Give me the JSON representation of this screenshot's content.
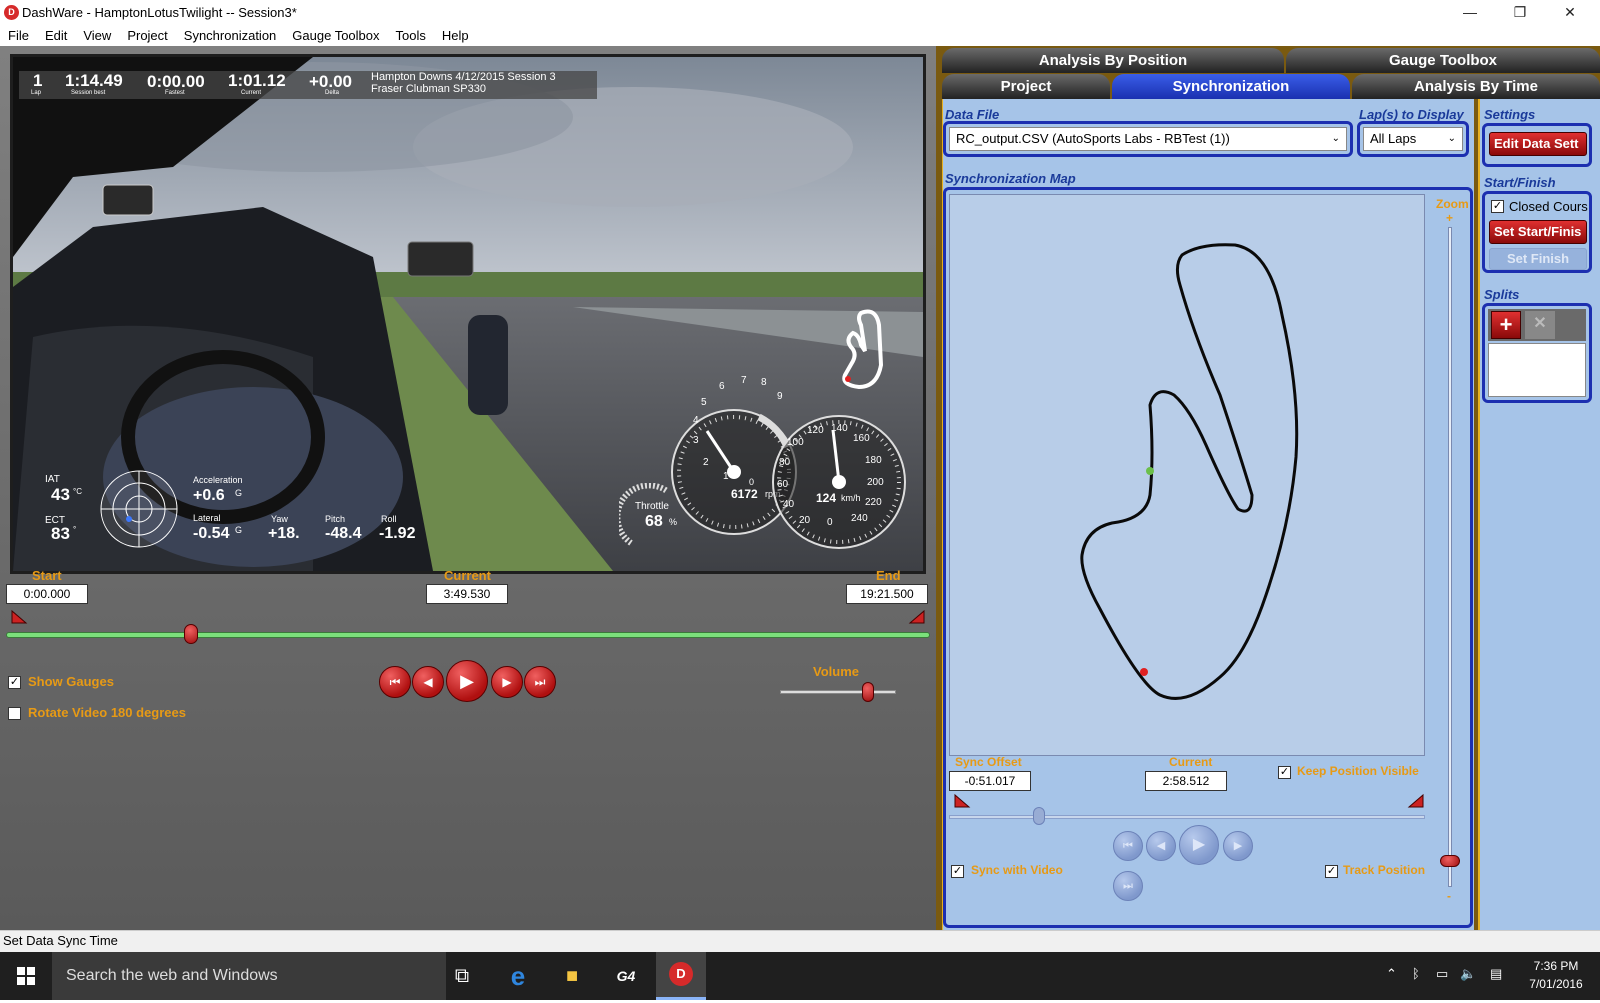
{
  "window": {
    "title": "DashWare - HamptonLotusTwilight -- Session3*",
    "app_icon_letter": "D",
    "controls": {
      "minimize": "—",
      "restore": "❐",
      "close": "✕"
    }
  },
  "menu": [
    "File",
    "Edit",
    "View",
    "Project",
    "Synchronization",
    "Gauge Toolbox",
    "Tools",
    "Help"
  ],
  "video_overlay": {
    "lap_value": "1",
    "lap_label": "Lap",
    "session_best_value": "1:14.49",
    "session_best_label": "Session best",
    "fastest_value": "0:00.00",
    "fastest_label": "Fastest",
    "current_value": "1:01.12",
    "current_label": "Current",
    "delta_value": "+0.00",
    "delta_label": "Delta",
    "session_line1": "Hampton Downs 4/12/2015 Session 3",
    "session_line2": "Fraser Clubman SP330",
    "iat_label": "IAT",
    "iat_value": "43",
    "iat_unit": "°C",
    "ect_label": "ECT",
    "ect_value": "83",
    "ect_unit": "°",
    "accel_label": "Acceleration",
    "accel_value": "+0.6",
    "accel_unit": "G",
    "lateral_label": "Lateral",
    "lateral_value": "-0.54",
    "lateral_unit": "G",
    "yaw_label": "Yaw",
    "yaw_value": "+18.",
    "pitch_label": "Pitch",
    "pitch_value": "-48.4",
    "roll_label": "Roll",
    "roll_value": "-1.92",
    "throttle_label": "Throttle",
    "throttle_value": "68",
    "throttle_unit": "%",
    "rpm_value": "6172",
    "rpm_unit": "rpm",
    "rpm_ticks": [
      "0",
      "1",
      "2",
      "3",
      "4",
      "5",
      "6",
      "7",
      "8",
      "9"
    ],
    "speed_value": "124",
    "speed_unit": "km/h",
    "speed_ticks": [
      "0",
      "20",
      "40",
      "60",
      "80",
      "100",
      "120",
      "140",
      "160",
      "180",
      "200",
      "220",
      "240"
    ]
  },
  "playback": {
    "start_label": "Start",
    "start_value": "0:00.000",
    "current_label": "Current",
    "current_value": "3:49.530",
    "end_label": "End",
    "end_value": "19:21.500",
    "position_fraction": 0.2,
    "show_gauges_label": "Show Gauges",
    "show_gauges_checked": true,
    "rotate_label": "Rotate Video 180 degrees",
    "rotate_checked": false,
    "volume_label": "Volume",
    "volume_fraction": 0.76,
    "buttons": [
      "first-lap",
      "previous",
      "play",
      "next",
      "last-lap"
    ]
  },
  "tabs": {
    "row1": [
      "Analysis By Position",
      "Gauge Toolbox"
    ],
    "row2": [
      "Project",
      "Synchronization",
      "Analysis By Time"
    ],
    "active": "Synchronization"
  },
  "sync": {
    "data_file_label": "Data File",
    "data_file_value": "RC_output.CSV (AutoSports Labs - RBTest (1))",
    "laps_label": "Lap(s) to Display",
    "laps_value": "All Laps",
    "map_label": "Synchronization Map",
    "zoom_label": "Zoom",
    "zoom_plus": "+",
    "zoom_minus": "-",
    "zoom_fraction": 0.96,
    "sync_offset_label": "Sync Offset",
    "sync_offset_value": "-0:51.017",
    "current_label": "Current",
    "current_value": "2:58.512",
    "keep_visible_label": "Keep Position Visible",
    "keep_visible_checked": true,
    "slider_fraction": 0.19,
    "sync_video_label": "Sync with Video",
    "sync_video_checked": true,
    "track_position_label": "Track Position",
    "track_position_checked": true
  },
  "settings": {
    "settings_label": "Settings",
    "edit_button": "Edit Data Sett",
    "startfinish_label": "Start/Finish",
    "closed_course_label": "Closed Cours",
    "closed_course_checked": true,
    "set_start_button": "Set Start/Finis",
    "set_finish_button": "Set Finish",
    "splits_label": "Splits",
    "add_split": "+",
    "remove_split": "✕"
  },
  "status": {
    "text": "Set Data Sync Time"
  },
  "taskbar": {
    "search_placeholder": "Search the web and Windows",
    "time": "7:36 PM",
    "date": "7/01/2016",
    "pinned": [
      "task-view",
      "edge",
      "file-explorer",
      "g4",
      "dashware"
    ]
  },
  "colors": {
    "accent_orange": "#e79a15",
    "tab_active": "#2a45d0",
    "sync_panel_bg": "#a6c4e8",
    "red_button": "#c01818",
    "slider_green": "#7be07b"
  }
}
